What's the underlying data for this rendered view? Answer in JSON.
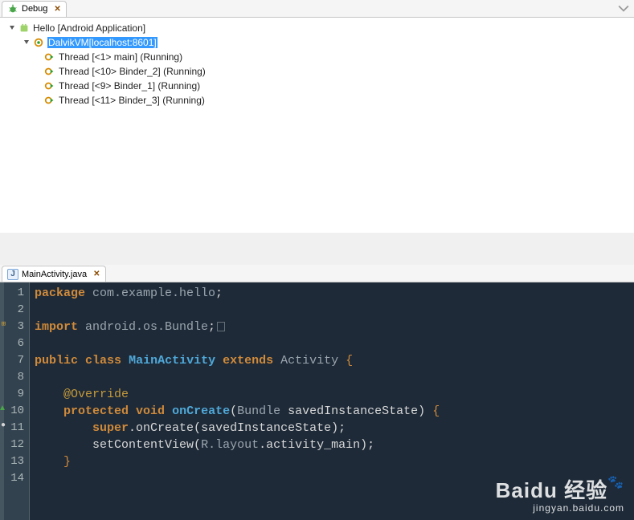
{
  "debug": {
    "tab_label": "Debug",
    "tree": {
      "app": {
        "label": "Hello [Android Application]"
      },
      "vm": {
        "label": "DalvikVM[localhost:8601]",
        "selected": true
      },
      "threads": [
        {
          "label": "Thread [<1> main] (Running)"
        },
        {
          "label": "Thread [<10> Binder_2] (Running)"
        },
        {
          "label": "Thread [<9> Binder_1] (Running)"
        },
        {
          "label": "Thread [<11> Binder_3] (Running)"
        }
      ]
    }
  },
  "editor": {
    "tab_label": "MainActivity.java",
    "line_numbers": [
      "1",
      "2",
      "3",
      "6",
      "7",
      "8",
      "9",
      "10",
      "11",
      "12",
      "13",
      "14"
    ],
    "code": {
      "l1_kw": "package",
      "l1_pkg": " com.example.hello",
      "l3_kw": "import",
      "l3_pkg": " android.os.Bundle",
      "l7_kw1": "public",
      "l7_kw2": "class",
      "l7_cls": "MainActivity",
      "l7_kw3": "extends",
      "l7_sup": "Activity",
      "l9_ann": "@Override",
      "l10_kw1": "protected",
      "l10_kw2": "void",
      "l10_meth": "onCreate",
      "l10_ptype": "Bundle",
      "l10_pname": "savedInstanceState",
      "l11_super": "super",
      "l11_call": ".onCreate",
      "l11_arg": "savedInstanceState",
      "l12_call": "setContentView",
      "l12_r": "R",
      "l12_layout": ".layout",
      "l12_name": ".activity_main"
    }
  },
  "watermark": {
    "brand": "Baidu 经验",
    "url": "jingyan.baidu.com"
  }
}
